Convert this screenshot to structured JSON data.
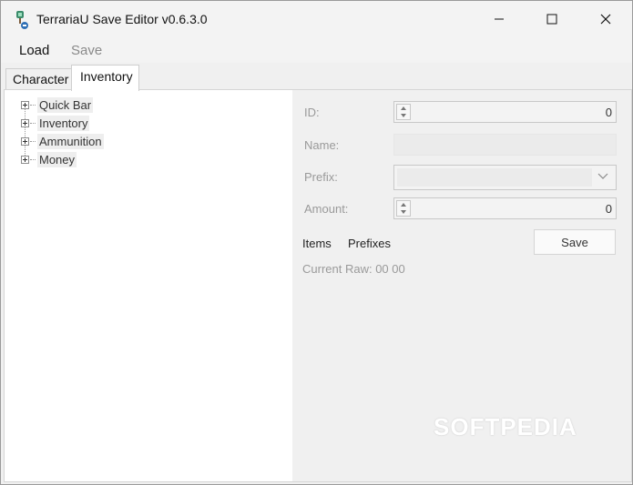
{
  "window": {
    "title": "TerrariaU Save Editor v0.6.3.0"
  },
  "menu": {
    "load": "Load",
    "save": "Save"
  },
  "tabs": [
    {
      "label": "Character"
    },
    {
      "label": "Inventory",
      "active": true
    }
  ],
  "tree": {
    "items": [
      {
        "label": "Quick Bar"
      },
      {
        "label": "Inventory"
      },
      {
        "label": "Ammunition"
      },
      {
        "label": "Money"
      }
    ]
  },
  "details": {
    "id_label": "ID:",
    "id_value": "0",
    "name_label": "Name:",
    "prefix_label": "Prefix:",
    "amount_label": "Amount:",
    "amount_value": "0",
    "items_link": "Items",
    "prefixes_link": "Prefixes",
    "save_button": "Save",
    "current_raw": "Current Raw: 00 00"
  },
  "watermark": "SOFTPEDIA",
  "colors": {
    "window_bg": "#f0f0f0",
    "panel_bg": "#ffffff",
    "disabled_text": "#9a9a9a"
  }
}
